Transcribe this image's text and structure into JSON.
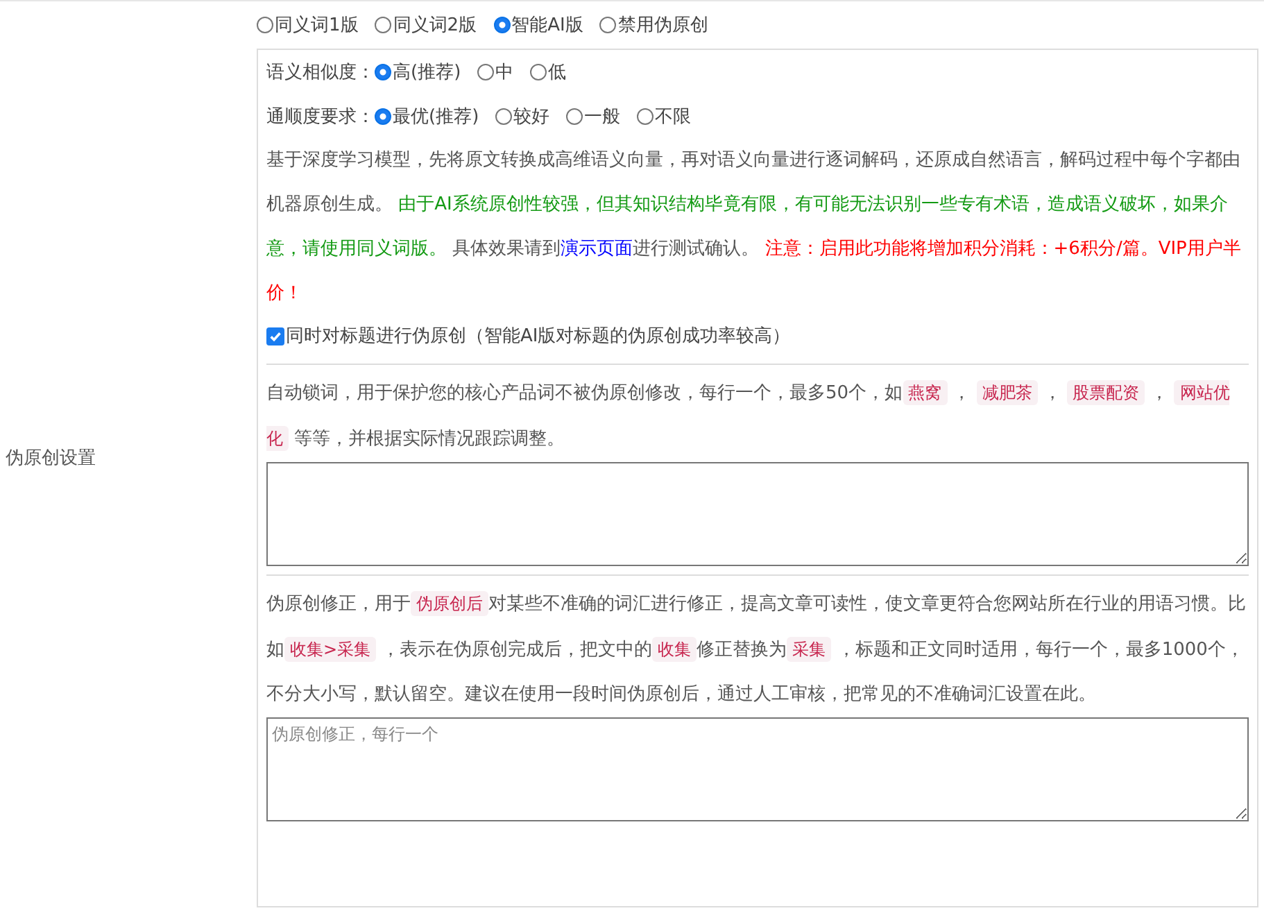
{
  "modes": [
    {
      "label": "同义词1版",
      "selected": false
    },
    {
      "label": "同义词2版",
      "selected": false
    },
    {
      "label": "智能AI版",
      "selected": true
    },
    {
      "label": "禁用伪原创",
      "selected": false
    }
  ],
  "section_label": "伪原创设置",
  "option_groups": [
    {
      "label": "语义相似度：",
      "options": [
        {
          "label": "高(推荐)",
          "selected": true
        },
        {
          "label": "中",
          "selected": false
        },
        {
          "label": "低",
          "selected": false
        }
      ]
    },
    {
      "label": "通顺度要求：",
      "options": [
        {
          "label": "最优(推荐)",
          "selected": true
        },
        {
          "label": "较好",
          "selected": false
        },
        {
          "label": "一般",
          "selected": false
        },
        {
          "label": "不限",
          "selected": false
        }
      ]
    }
  ],
  "description": [
    {
      "kind": "text",
      "text": "基于深度学习模型，先将原文转换成高维语义向量，再对语义向量进行逐词解码，还原成自然语言，解码过程中每个字都由机器原创生成。 "
    },
    {
      "kind": "notice",
      "text": "由于AI系统原创性较强，但其知识结构毕竟有限，有可能无法识别一些专有术语，造成语义破坏，如果介意，请使用同义词版。"
    },
    {
      "kind": "text",
      "text": " 具体效果请到"
    },
    {
      "kind": "link",
      "text": "演示页面"
    },
    {
      "kind": "text",
      "text": "进行测试确认。 "
    },
    {
      "kind": "warning",
      "text": "注意：启用此功能将增加积分消耗：+6积分/篇。VIP用户半价！"
    }
  ],
  "title_option": {
    "label": "同时对标题进行伪原创（智能AI版对标题的伪原创成功率较高）",
    "checked": true
  },
  "lock_words": {
    "help": [
      {
        "kind": "text",
        "text": "自动锁词，用于保护您的核心产品词不被伪原创修改，每行一个，最多50个，如"
      },
      {
        "kind": "tag",
        "text": "燕窝"
      },
      {
        "kind": "text",
        "text": " ， "
      },
      {
        "kind": "tag",
        "text": "减肥茶"
      },
      {
        "kind": "text",
        "text": " ， "
      },
      {
        "kind": "tag",
        "text": "股票配资"
      },
      {
        "kind": "text",
        "text": " ， "
      },
      {
        "kind": "tag",
        "text": "网站优化"
      },
      {
        "kind": "text",
        "text": " 等等，并根据实际情况跟踪调整。"
      }
    ]
  },
  "corrections": {
    "help": [
      {
        "kind": "text",
        "text": "伪原创修正，用于"
      },
      {
        "kind": "tag",
        "text": "伪原创后"
      },
      {
        "kind": "text",
        "text": "对某些不准确的词汇进行修正，提高文章可读性，使文章更符合您网站所在行业的用语习惯。比如"
      },
      {
        "kind": "tag",
        "text": "收集>采集"
      },
      {
        "kind": "text",
        "text": " ，表示在伪原创完成后，把文中的"
      },
      {
        "kind": "tag",
        "text": "收集"
      },
      {
        "kind": "text",
        "text": "修正替换为"
      },
      {
        "kind": "tag",
        "text": "采集"
      },
      {
        "kind": "text",
        "text": " ，标题和正文同时适用，每行一个，最多1000个，不分大小写，默认留空。建议在使用一段时间伪原创后，通过人工审核，把常见的不准确词汇设置在此。"
      }
    ],
    "placeholder": "伪原创修正，每行一个"
  }
}
